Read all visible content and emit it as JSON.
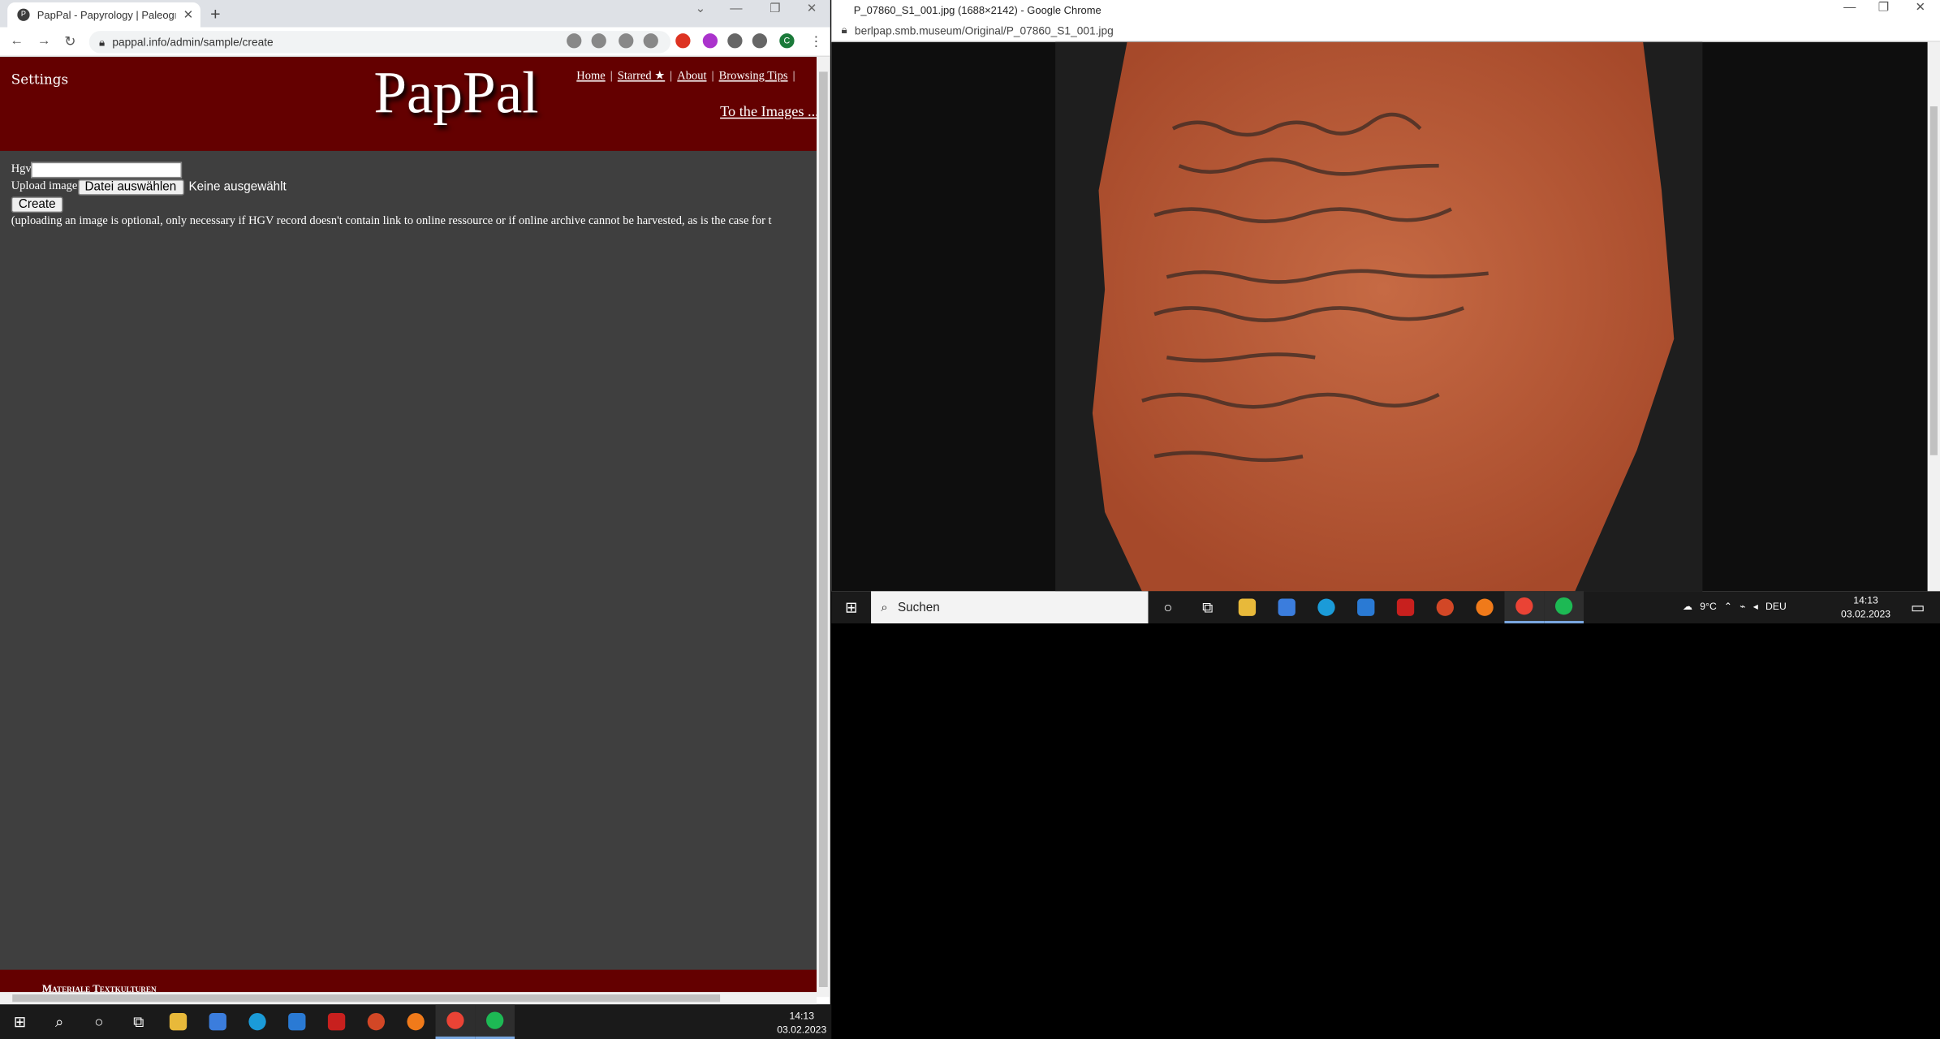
{
  "left_browser": {
    "tab_title": "PapPal - Papyrology | Paleograph",
    "url": "pappal.info/admin/sample/create",
    "profile_initial": "C"
  },
  "site": {
    "settings": "Settings",
    "logo": "PapPal",
    "nav": [
      "Home",
      "Starred ★",
      "About",
      "Browsing Tips"
    ],
    "to_images": "To the Images ...",
    "footer": "Materiale Textkulturen"
  },
  "form": {
    "hgv_label": "Hgv",
    "upload_label": "Upload image",
    "file_button": "Datei auswählen",
    "file_status": "Keine ausgewählt",
    "create_button": "Create",
    "note": "(uploading an image is optional, only necessary if HGV record doesn't contain link to online ressource or if online archive cannot be harvested, as is the case for t"
  },
  "right_browser": {
    "window_title": "P_07860_S1_001.jpg (1688×2142) - Google Chrome",
    "url": "berlpap.smb.museum/Original/P_07860_S1_001.jpg"
  },
  "taskbar": {
    "search_placeholder": "Suchen",
    "weather": "9°C",
    "language": "DEU",
    "time": "14:13",
    "date": "03.02.2023",
    "icons": [
      "windows-icon",
      "search-icon",
      "cortana-icon",
      "task-view-icon",
      "file-explorer-icon",
      "store-icon",
      "edge-icon",
      "mail-icon",
      "acrobat-icon",
      "powerpoint-icon",
      "firefox-icon",
      "chrome-icon",
      "spotify-icon"
    ]
  },
  "colors": {
    "header": "#640000",
    "page_bg": "#3f3f3f",
    "ostracon": "#b8562f"
  }
}
